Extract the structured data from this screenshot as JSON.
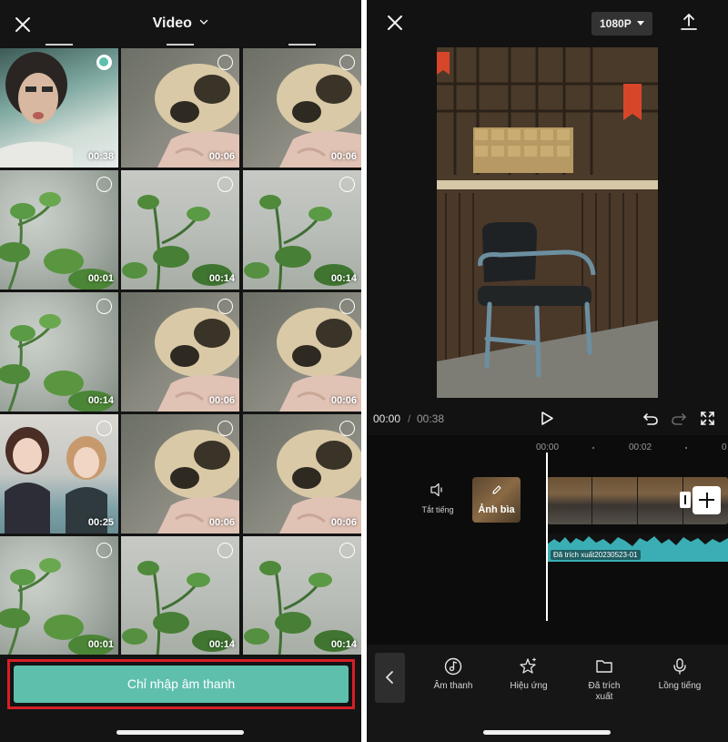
{
  "left": {
    "title": "Video",
    "thumbnails": [
      {
        "duration": "00:38",
        "art": "girl",
        "selected": true
      },
      {
        "duration": "00:06",
        "art": "dog",
        "selected": false
      },
      {
        "duration": "00:06",
        "art": "dog",
        "selected": false
      },
      {
        "duration": "00:01",
        "art": "plant",
        "selected": false
      },
      {
        "duration": "00:14",
        "art": "plant2",
        "selected": false
      },
      {
        "duration": "00:14",
        "art": "plant2",
        "selected": false
      },
      {
        "duration": "00:14",
        "art": "plant",
        "selected": false
      },
      {
        "duration": "00:06",
        "art": "dog",
        "selected": false
      },
      {
        "duration": "00:06",
        "art": "dog",
        "selected": false
      },
      {
        "duration": "00:25",
        "art": "dolls",
        "selected": false
      },
      {
        "duration": "00:06",
        "art": "dog",
        "selected": false
      },
      {
        "duration": "00:06",
        "art": "dog",
        "selected": false
      },
      {
        "duration": "00:01",
        "art": "plant",
        "selected": false
      },
      {
        "duration": "00:14",
        "art": "plant2",
        "selected": false
      },
      {
        "duration": "00:14",
        "art": "plant2",
        "selected": false
      }
    ],
    "import_audio_label": "Chỉ nhập âm thanh",
    "accent_color": "#5fbfad",
    "highlight_color": "#d61f26"
  },
  "right": {
    "resolution": "1080P",
    "current_time": "00:00",
    "time_separator": "/",
    "total_time": "00:38",
    "ruler": [
      "00:00",
      "00:02"
    ],
    "mute_label": "Tắt tiếng",
    "cover_label": "Ảnh bìa",
    "audio_track_label": "Đã trích xuất20230523-01",
    "audio_color": "#3aaeb4",
    "tools": [
      {
        "label": "Âm thanh",
        "icon": "music-note-icon"
      },
      {
        "label": "Hiệu ứng",
        "icon": "sparkle-star-icon"
      },
      {
        "label": "Đã trích xuất",
        "icon": "folder-icon"
      },
      {
        "label": "Lồng tiếng",
        "icon": "microphone-icon"
      }
    ]
  }
}
